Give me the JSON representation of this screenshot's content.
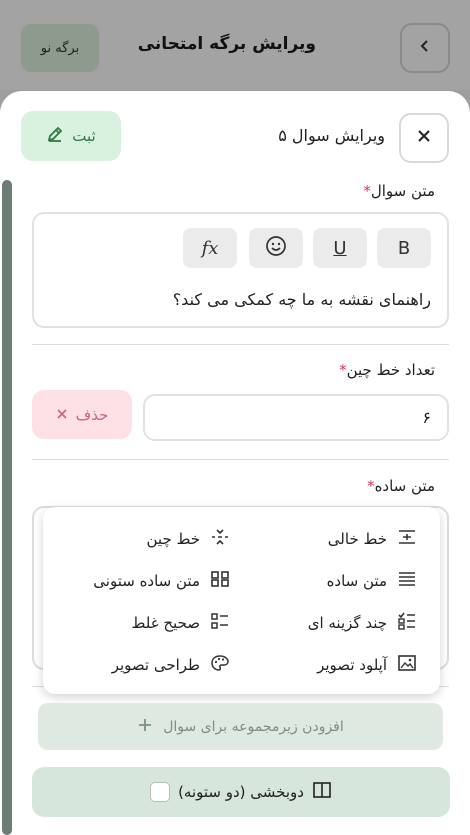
{
  "header": {
    "title": "ویرایش برگه امتحانی",
    "new_sheet_button": "برگه نو",
    "back_icon": "chevron-left-icon"
  },
  "editor": {
    "title": "ویرایش سوال ۵",
    "save_label": "ثبت",
    "close_icon": "close-icon",
    "question_text_label": "متن سوال",
    "toolbar": {
      "bold": "B",
      "underline": "U",
      "emoji": "emoji-icon",
      "formula": "fx"
    },
    "question_text": "راهنمای نقشه به ما چه کمکی می کند؟",
    "line_count_label": "تعداد خط چین",
    "line_count_value": "۶",
    "delete_label": "حذف",
    "answer_type_label": "متن ساده",
    "answer_type_options": [
      {
        "label": "خط خالی",
        "icon": "blank-line-icon"
      },
      {
        "label": "خط چین",
        "icon": "dashed-line-icon"
      },
      {
        "label": "متن ساده",
        "icon": "text-lines-icon"
      },
      {
        "label": "متن ساده ستونی",
        "icon": "grid-icon"
      },
      {
        "label": "چند گزینه ای",
        "icon": "multiple-choice-icon"
      },
      {
        "label": "صحیح غلط",
        "icon": "true-false-icon"
      },
      {
        "label": "آپلود تصویر",
        "icon": "image-icon"
      },
      {
        "label": "طراحی تصویر",
        "icon": "palette-icon"
      }
    ],
    "add_sub_label": "افزودن زیرمجموعه برای سوال",
    "two_column_label": "دوبخشی (دو ستونه)"
  },
  "colors": {
    "accent_green": "#2f7a45",
    "danger": "#d6335b"
  }
}
